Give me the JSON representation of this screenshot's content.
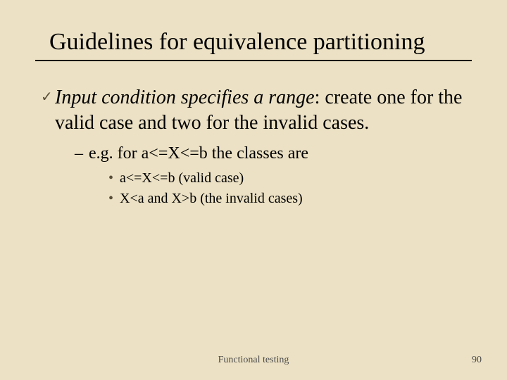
{
  "title": "Guidelines for equivalence partitioning",
  "bullets": {
    "main": {
      "italic_lead": "Input condition specifies a range",
      "rest": ": create one for the valid case and two for the invalid cases."
    },
    "sub": "e.g. for a<=X<=b the classes are",
    "sub_items": [
      "a<=X<=b  (valid case)",
      "X<a and X>b (the invalid cases)"
    ]
  },
  "footer": {
    "center": "Functional testing",
    "page": "90"
  },
  "glyphs": {
    "check": "✓",
    "dash": "–",
    "dot": "•"
  }
}
